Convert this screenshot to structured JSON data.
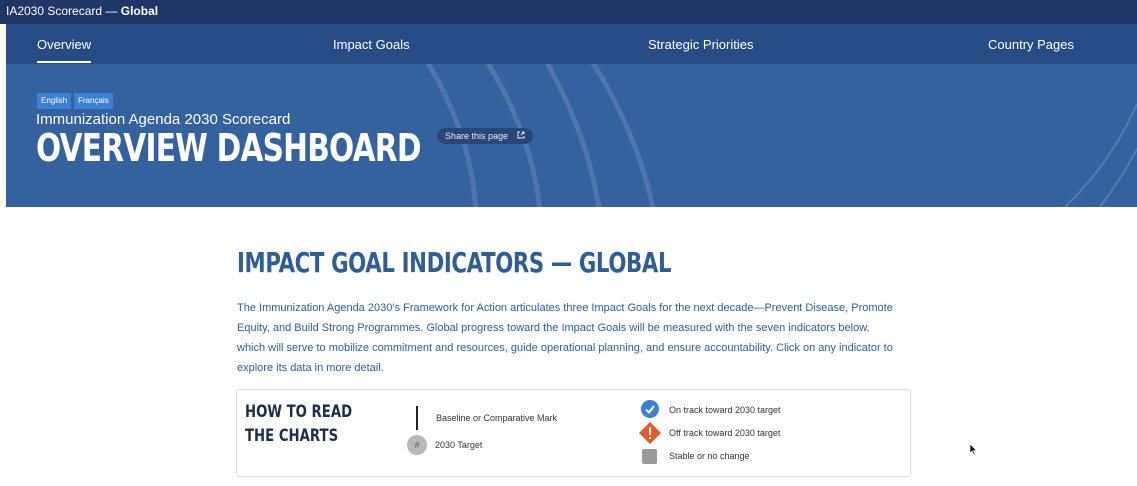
{
  "window": {
    "title_prefix": "IA2030 Scorecard — ",
    "title_bold": "Global"
  },
  "nav": {
    "items": [
      "Overview",
      "Impact Goals",
      "Strategic Priorities",
      "Country Pages"
    ],
    "active": "Overview"
  },
  "hero": {
    "languages": [
      "English",
      "Français"
    ],
    "subtitle": "Immunization Agenda 2030 Scorecard",
    "title": "OVERVIEW DASHBOARD",
    "share_label": "Share this page"
  },
  "section": {
    "title": "IMPACT GOAL INDICATORS — GLOBAL",
    "intro": "The Immunization Agenda 2030’s Framework for Action articulates three Impact Goals for the next decade—Prevent Disease, Promote Equity, and Build Strong Programmes. Global progress toward the Impact Goals will be measured with the seven indicators below, which will serve to mobilize commitment and resources, guide operational planning, and ensure accountability. Click on any indicator to explore its data in more detail."
  },
  "legend": {
    "title": "HOW TO READ THE CHARTS",
    "baseline_label": "Baseline or Comparative Mark",
    "target_symbol": "#",
    "target_label": "2030 Target",
    "on_track_label": "On track toward 2030 target",
    "off_track_label": "Off track toward 2030 target",
    "stable_label": "Stable or no change"
  },
  "colors": {
    "topbar": "#1f3667",
    "nav": "#274b85",
    "hero": "#33629f",
    "accent_blue": "#3b7fd6",
    "off_track": "#e05c2d",
    "stable": "#9a9a9a",
    "heading": "#2e5d98"
  },
  "icons": [
    "check-circle-icon",
    "exclamation-diamond-icon",
    "gray-square-icon",
    "external-link-icon",
    "mouse-cursor-icon"
  ]
}
